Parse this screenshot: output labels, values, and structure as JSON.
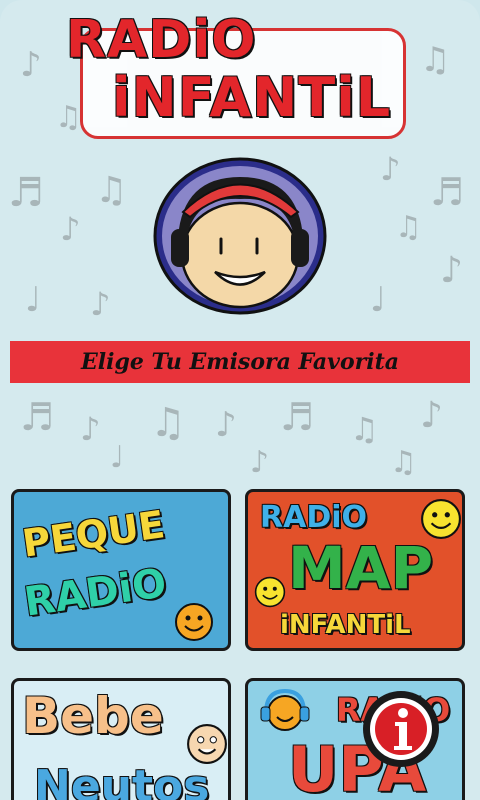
{
  "logo": {
    "line1": "RADiO",
    "line2": "iNFANTiL"
  },
  "banner": {
    "text": "Elige Tu Emisora Favorita"
  },
  "stations": [
    {
      "line1": "PEQUE",
      "line2": "RADiO"
    },
    {
      "line1": "RADiO",
      "line2": "MAP",
      "line3": "iNFANTiL"
    },
    {
      "line1": "Bebe",
      "line2": "Neutos"
    },
    {
      "line1": "RADiO",
      "line2": "UPA"
    }
  ],
  "icons": {
    "info": "info-icon",
    "mascot": "mascot-headphones-icon"
  },
  "colors": {
    "banner": "#e8333a",
    "background": "#d5eaee",
    "accent_red": "#e3262b"
  }
}
